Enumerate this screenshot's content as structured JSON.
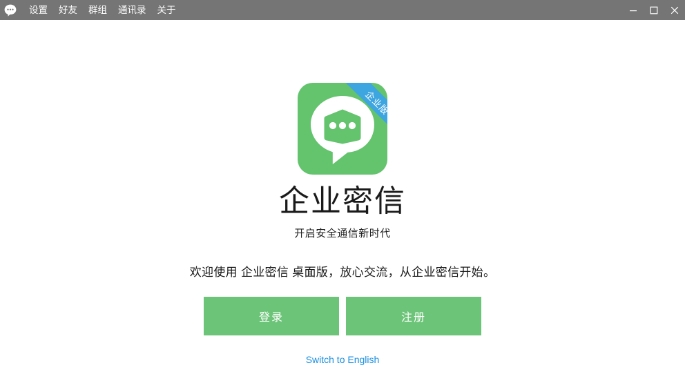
{
  "titlebar": {
    "app_icon": "chat-bubble-icon",
    "menu_items": [
      {
        "label": "设置",
        "name": "menu-item-settings"
      },
      {
        "label": "好友",
        "name": "menu-item-friends"
      },
      {
        "label": "群组",
        "name": "menu-item-groups"
      },
      {
        "label": "通讯录",
        "name": "menu-item-contacts"
      },
      {
        "label": "关于",
        "name": "menu-item-about"
      }
    ],
    "window_controls": {
      "minimize": "minimize-icon",
      "maximize": "maximize-icon",
      "close": "close-icon"
    },
    "background_color": "#757575"
  },
  "main": {
    "logo": {
      "icon_name": "enterprise-chat-logo",
      "background_color": "#64c36d",
      "ribbon_text": "企业版",
      "ribbon_color": "#3da5e0"
    },
    "app_title": "企业密信",
    "app_subtitle": "开启安全通信新时代",
    "welcome_text": "欢迎使用 企业密信 桌面版，放心交流，从企业密信开始。",
    "login_button": "登录",
    "register_button": "注册",
    "switch_language_link": "Switch to English",
    "button_color": "#6bc477",
    "link_color": "#1a8fe0"
  }
}
